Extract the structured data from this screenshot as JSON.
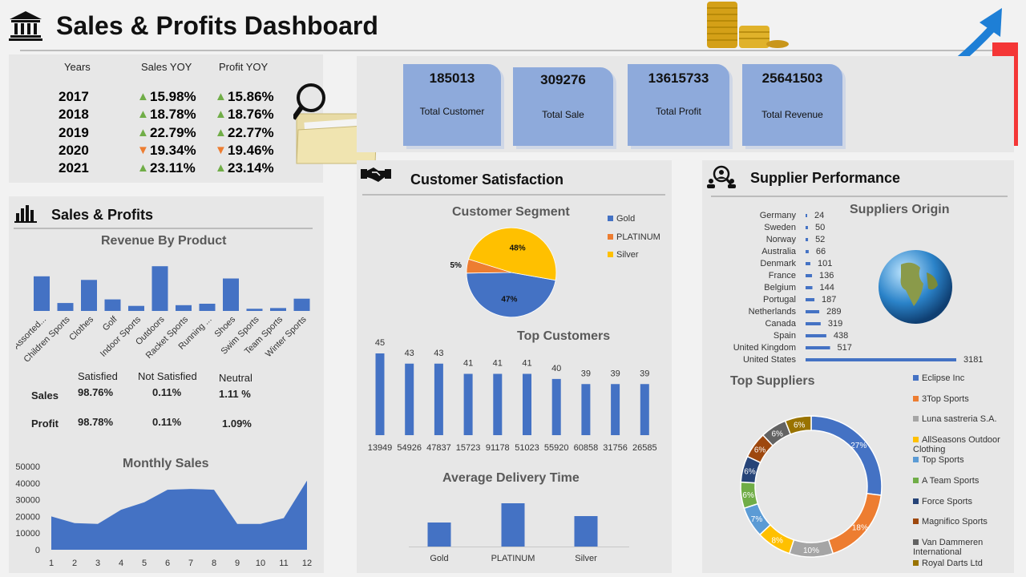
{
  "header": {
    "title": "Sales & Profits Dashboard"
  },
  "yoy": {
    "headers": [
      "Years",
      "Sales YOY",
      "Profit YOY"
    ],
    "rows": [
      {
        "year": "2017",
        "sales": "15.98%",
        "profit": "15.86%",
        "sales_dir": "up",
        "profit_dir": "up"
      },
      {
        "year": "2018",
        "sales": "18.78%",
        "profit": "18.76%",
        "sales_dir": "up",
        "profit_dir": "up"
      },
      {
        "year": "2019",
        "sales": "22.79%",
        "profit": "22.77%",
        "sales_dir": "up",
        "profit_dir": "up"
      },
      {
        "year": "2020",
        "sales": "19.34%",
        "profit": "19.46%",
        "sales_dir": "down",
        "profit_dir": "down"
      },
      {
        "year": "2021",
        "sales": "23.11%",
        "profit": "23.14%",
        "sales_dir": "up",
        "profit_dir": "up"
      }
    ]
  },
  "kpis": [
    {
      "value": "185013",
      "label": "Total Customer"
    },
    {
      "value": "309276",
      "label": "Total Sale"
    },
    {
      "value": "13615733",
      "label": "Total Profit"
    },
    {
      "value": "25641503",
      "label": "Total Revenue"
    }
  ],
  "sales_profits": {
    "title": "Sales & Profits",
    "satisfaction_table": {
      "headers": [
        "Satisfied",
        "Not Satisfied",
        "Neutral"
      ],
      "rows": [
        {
          "label": "Sales",
          "values": [
            "98.76%",
            "0.11%",
            "1.11 %"
          ]
        },
        {
          "label": "Profit",
          "values": [
            "98.78%",
            "0.11%",
            "1.09%"
          ]
        }
      ]
    }
  },
  "customer_satisfaction": {
    "title": "Customer Satisfaction"
  },
  "supplier_performance": {
    "title": "Supplier Performance"
  },
  "colors": {
    "bar": "#4472c4",
    "gold": "#4472c4",
    "platinum": "#ed7d31",
    "silver": "#ffc000",
    "up": "#70ad47",
    "down": "#ed7d31"
  },
  "chart_data": [
    {
      "type": "bar",
      "title": "Revenue By Product",
      "categories": [
        "Assorted...",
        "Children Sports",
        "Clothes",
        "Golf",
        "Indoor Sports",
        "Outdoors",
        "Racket Sports",
        "Running ...",
        "Shoes",
        "Swim Sports",
        "Team Sports",
        "Winter Sports"
      ],
      "values": [
        48,
        11,
        43,
        16,
        7,
        62,
        8,
        10,
        45,
        3,
        4,
        17
      ]
    },
    {
      "type": "area",
      "title": "Monthly Sales",
      "x": [
        1,
        2,
        3,
        4,
        5,
        6,
        7,
        8,
        9,
        10,
        11,
        12
      ],
      "values": [
        20000,
        16000,
        15500,
        24000,
        28500,
        36000,
        36500,
        36000,
        15500,
        15500,
        19000,
        41500
      ],
      "yticks": [
        0,
        10000,
        20000,
        30000,
        40000,
        50000
      ],
      "ylim": [
        0,
        50000
      ]
    },
    {
      "type": "pie",
      "title": "Customer Segment",
      "labels": [
        "Gold",
        "PLATINUM",
        "Silver"
      ],
      "values": [
        47,
        5,
        48
      ],
      "value_labels": [
        "47%",
        "5%",
        "48%"
      ]
    },
    {
      "type": "bar",
      "title": "Top Customers",
      "categories": [
        "13949",
        "54926",
        "47837",
        "15723",
        "91178",
        "51023",
        "55920",
        "60858",
        "31756",
        "26585"
      ],
      "values": [
        45,
        43,
        43,
        41,
        41,
        41,
        40,
        39,
        39,
        39
      ]
    },
    {
      "type": "bar",
      "title": "Average Delivery Time",
      "categories": [
        "Gold",
        "PLATINUM",
        "Silver"
      ],
      "values": [
        3.0,
        5.4,
        3.8
      ]
    },
    {
      "type": "bar",
      "orientation": "horizontal",
      "title": "Suppliers Origin",
      "categories": [
        "Germany",
        "Sweden",
        "Norway",
        "Australia",
        "Denmark",
        "France",
        "Belgium",
        "Portugal",
        "Netherlands",
        "Canada",
        "Spain",
        "United Kingdom",
        "United States"
      ],
      "values": [
        24,
        50,
        52,
        66,
        101,
        136,
        144,
        187,
        289,
        319,
        438,
        517,
        3181
      ]
    },
    {
      "type": "pie",
      "donut": true,
      "title": "Top Suppliers",
      "labels": [
        "Eclipse Inc",
        "3Top Sports",
        "Luna sastreria S.A.",
        "AllSeasons Outdoor Clothing",
        "Top Sports",
        "A Team Sports",
        "Force Sports",
        "Magnifico Sports",
        "Van Dammeren International",
        "Royal Darts Ltd"
      ],
      "values": [
        27,
        18,
        10,
        8,
        7,
        6,
        6,
        6,
        6,
        6
      ],
      "value_labels": [
        "27%",
        "18%",
        "10%",
        "8%",
        "7%",
        "6%",
        "6%",
        "6%",
        "6%",
        "6%"
      ],
      "colors": [
        "#4472c4",
        "#ed7d31",
        "#a5a5a5",
        "#ffc000",
        "#5b9bd5",
        "#70ad47",
        "#264478",
        "#9e480e",
        "#636363",
        "#997300"
      ]
    }
  ]
}
